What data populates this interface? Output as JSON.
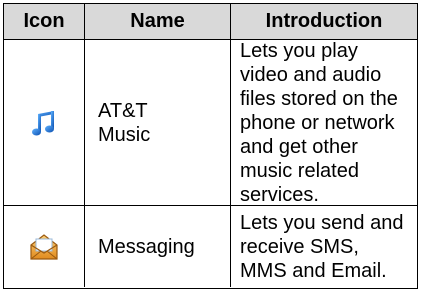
{
  "table": {
    "headers": {
      "icon": "Icon",
      "name": "Name",
      "intro": "Introduction"
    },
    "rows": [
      {
        "icon": "music-note-icon",
        "name": "AT&T\nMusic",
        "intro": "Lets you play video and audio files stored on the phone or network and get other music related services."
      },
      {
        "icon": "envelope-icon",
        "name": "Messaging",
        "intro": "Lets you send and receive SMS, MMS and Email."
      }
    ]
  },
  "colors": {
    "header_bg": "#d9d9d9",
    "border": "#000000",
    "music_icon": "#1b6fd3",
    "envelope_icon": "#e9a23b"
  }
}
